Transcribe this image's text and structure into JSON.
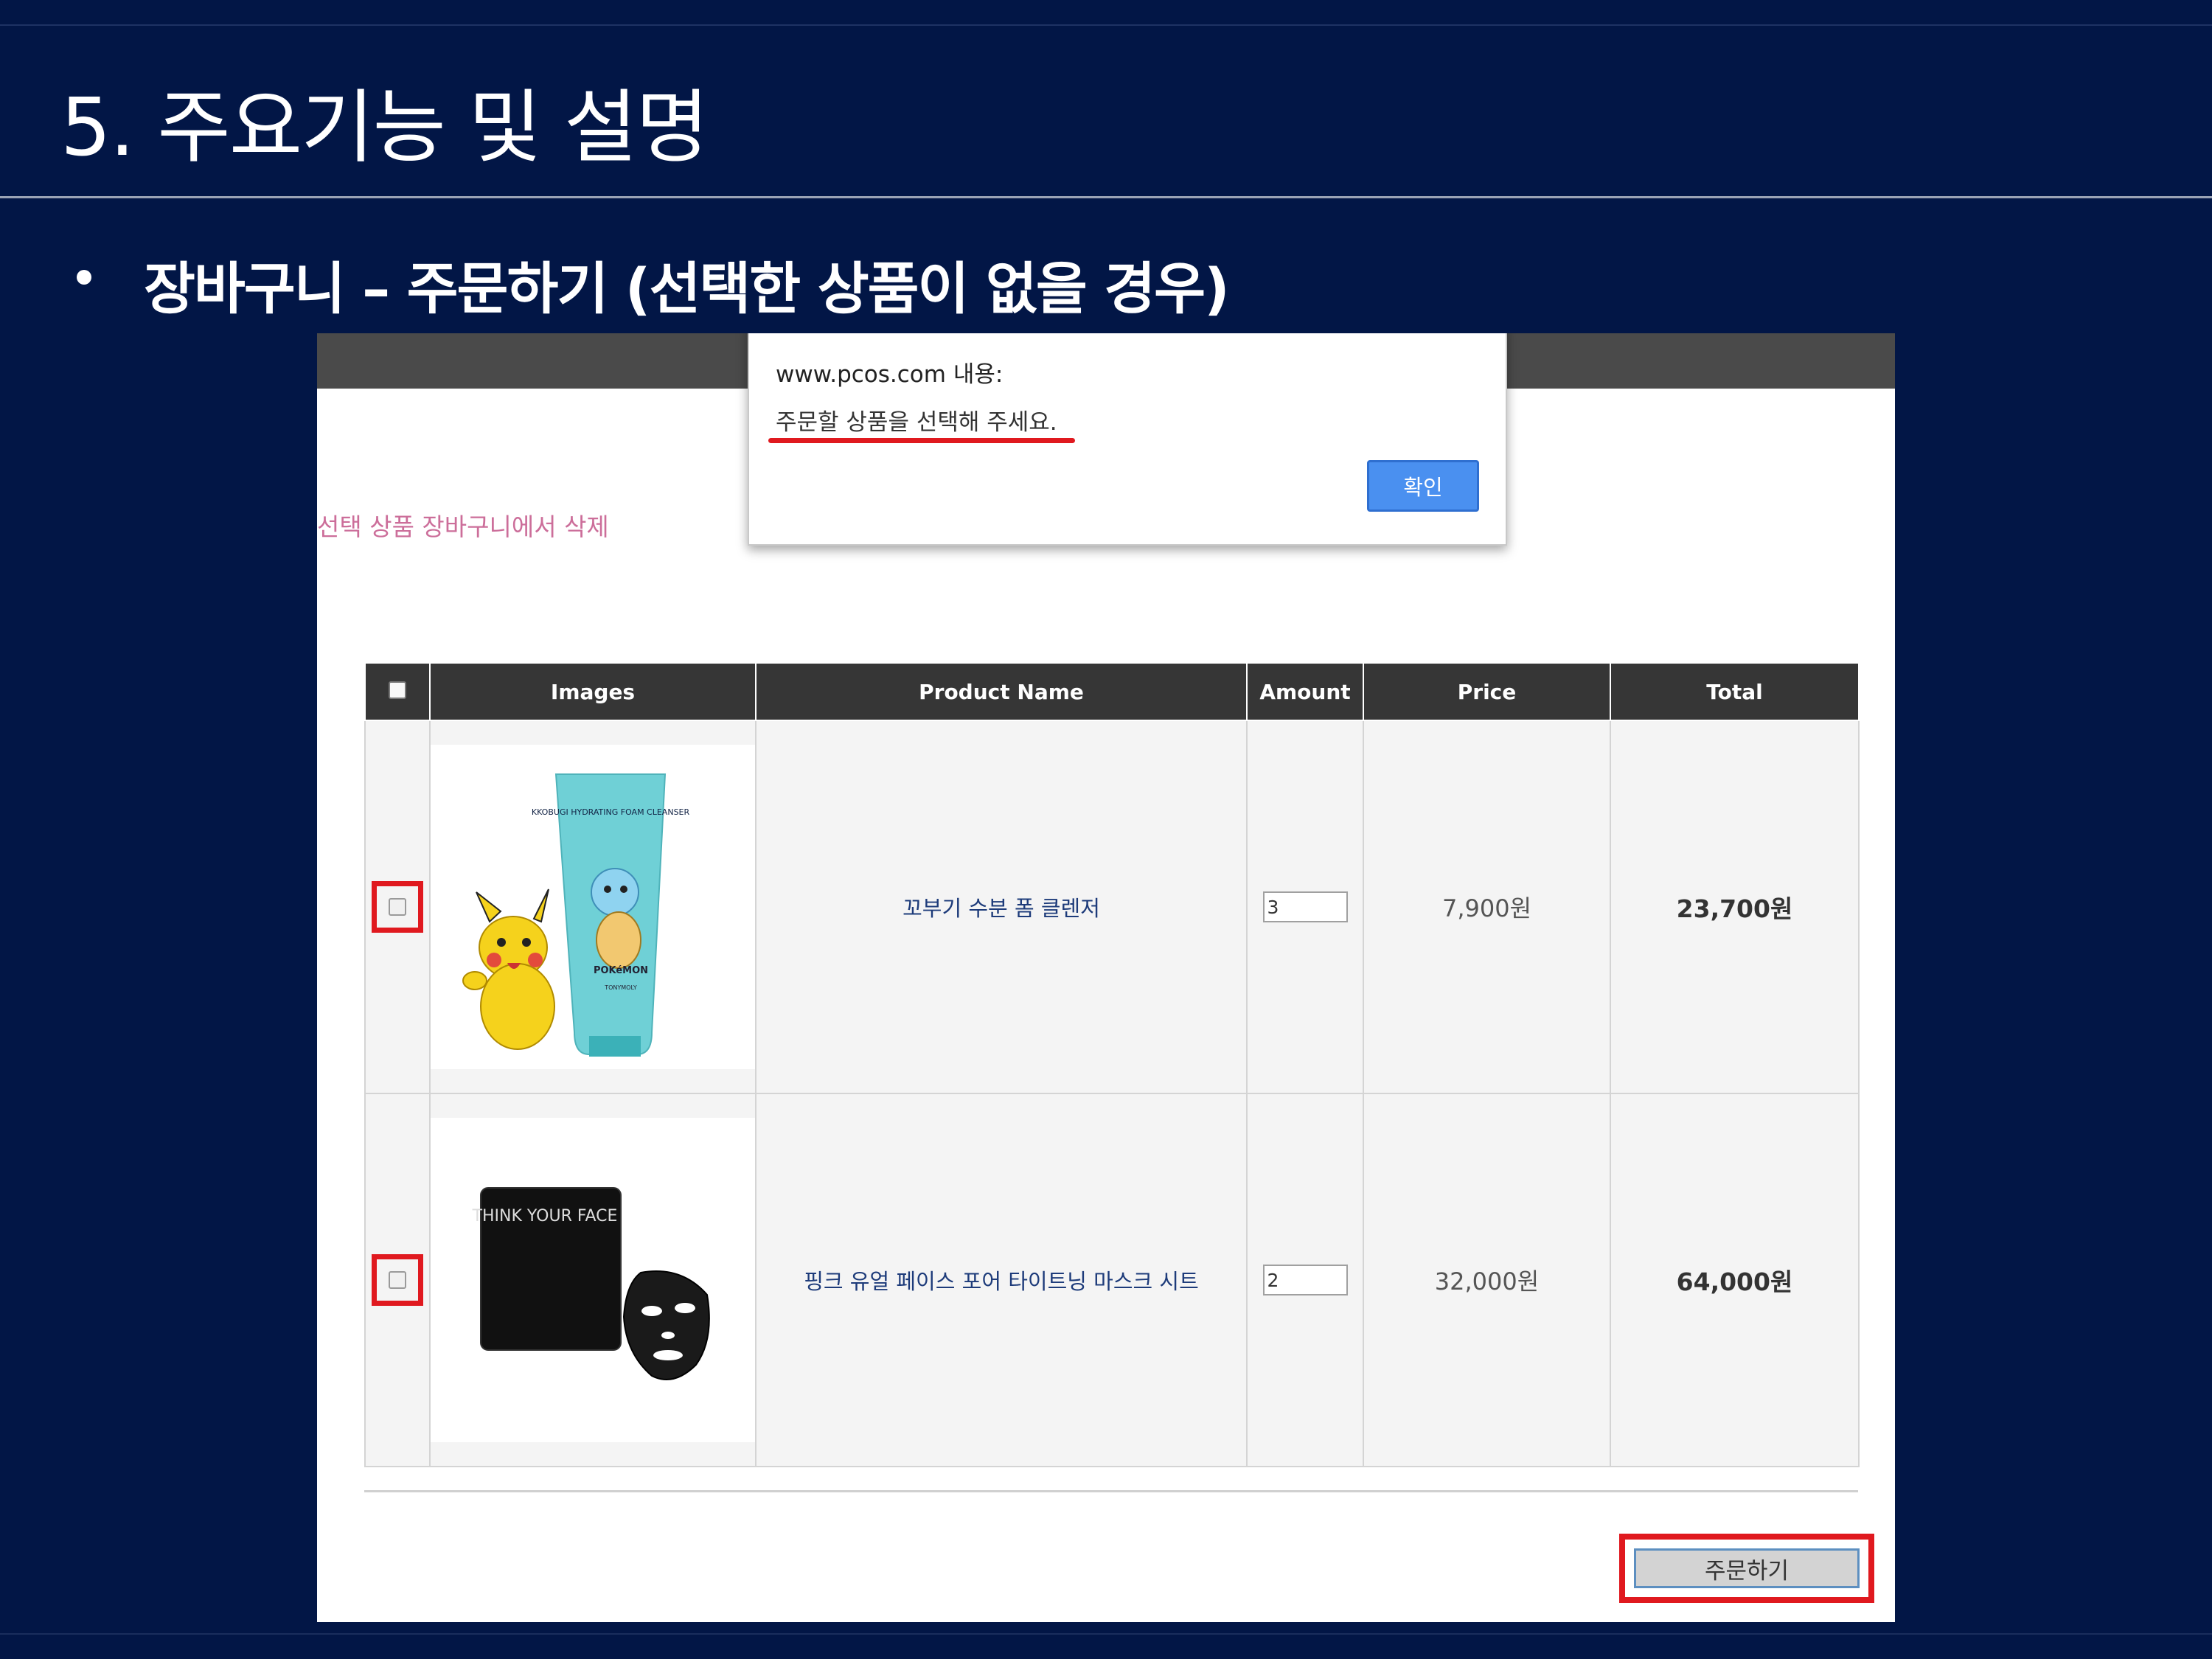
{
  "slide": {
    "title": "5. 주요기능 및 설명",
    "subtitle": "장바구니 – 주문하기 (선택한 상품이 없을 경우)"
  },
  "page": {
    "delete_selected_link": "선택 상품 장바구니에서 삭제",
    "order_button": "주문하기"
  },
  "alert": {
    "origin": "www.pcos.com 내용:",
    "message": "주문할 상품을 선택해 주세요.",
    "ok_button": "확인"
  },
  "table": {
    "headers": [
      "Images",
      "Product Name",
      "Amount",
      "Price",
      "Total"
    ],
    "rows": [
      {
        "product_name": "꼬부기 수분 폼 클렌저",
        "amount": "3",
        "price": "7,900원",
        "total": "23,700원",
        "image": "foam-cleanser-pikachu-image"
      },
      {
        "product_name": "핑크 유얼 페이스 포어 타이트닝 마스크 시트",
        "amount": "2",
        "price": "32,000원",
        "total": "64,000원",
        "image": "think-your-face-mask-image"
      }
    ]
  },
  "product_art": {
    "tube_text": "KKOBUGI HYDRATING FOAM CLEANSER",
    "tube_logo": "POKéMON",
    "tube_brand": "TONYMOLY",
    "mask_pack_text": "THINK YOUR FACE"
  },
  "colors": {
    "slide_background": "#021646",
    "highlight_red": "#e0191f",
    "table_header": "#363636",
    "alert_button": "#4a90f0"
  }
}
